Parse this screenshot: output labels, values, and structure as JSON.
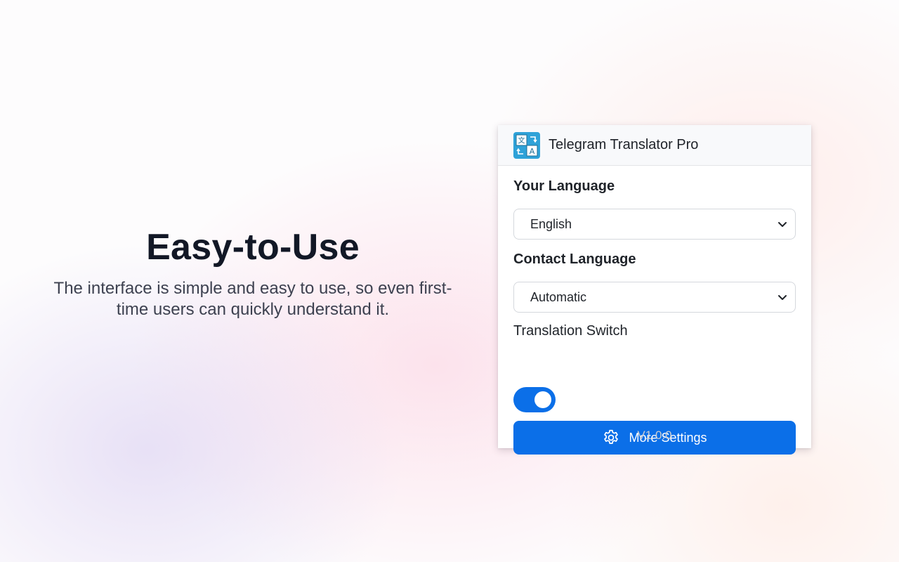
{
  "hero": {
    "title": "Easy-to-Use",
    "description": "The interface is simple and easy to use, so even first-time users can quickly understand it."
  },
  "popup": {
    "app_title": "Telegram Translator Pro",
    "logo_icon": "translate-icon",
    "your_language": {
      "label": "Your Language",
      "selected": "English"
    },
    "contact_language": {
      "label": "Contact Language",
      "selected": "Automatic"
    },
    "translation_switch": {
      "label": "Translation Switch",
      "enabled": true
    },
    "more_settings": {
      "label": "More Settings",
      "icon": "gear-icon"
    },
    "version": "V1.0.0"
  },
  "colors": {
    "accent": "#0b6fe8",
    "logo": "#2ea2d8",
    "title": "#121826"
  }
}
